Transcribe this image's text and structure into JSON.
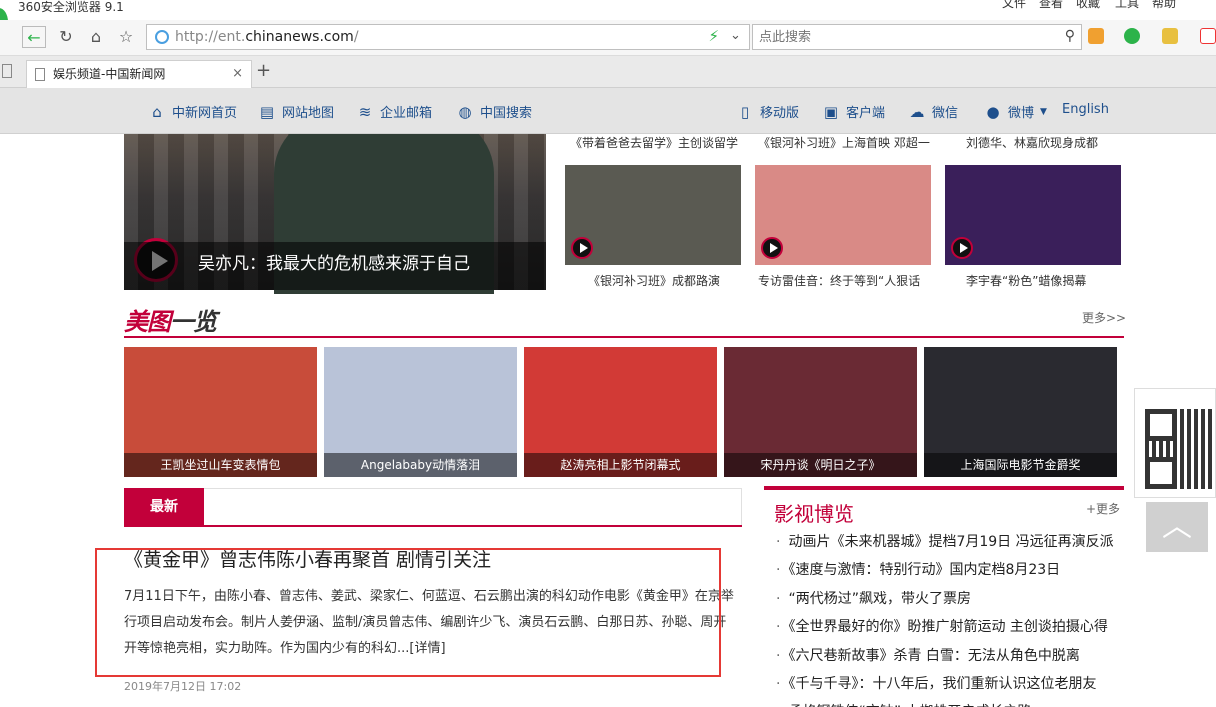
{
  "browser": {
    "title": "360安全浏览器 9.1",
    "menus": [
      "文件",
      "查看",
      "收藏",
      "工具",
      "帮助"
    ],
    "url_prefix": "http://ent.",
    "url_domain": "chinanews.com",
    "url_suffix": "/",
    "search_placeholder": "点此搜索",
    "tab_title": "娱乐频道-中国新闻网",
    "tab_close": "×",
    "new_tab": "+"
  },
  "sitenav": {
    "left": [
      {
        "label": "中新网首页",
        "icon": "home-icon"
      },
      {
        "label": "网站地图",
        "icon": "map-icon"
      },
      {
        "label": "企业邮箱",
        "icon": "rss-icon"
      },
      {
        "label": "中国搜索",
        "icon": "globe-icon"
      }
    ],
    "right": [
      {
        "label": "移动版",
        "icon": "mobile-icon"
      },
      {
        "label": "客户端",
        "icon": "app-icon"
      },
      {
        "label": "微信",
        "icon": "wechat-icon"
      },
      {
        "label": "微博",
        "icon": "weibo-icon"
      },
      {
        "label": "English",
        "icon": ""
      }
    ]
  },
  "hero": {
    "caption": "吴亦凡：我最大的危机感来源于自己"
  },
  "top_row": [
    "《带着爸爸去留学》主创谈留学",
    "《银河补习班》上海首映 邓超一",
    "刘德华、林嘉欣现身成都"
  ],
  "videos": [
    {
      "caption": "《银河补习班》成都路演",
      "color": "#5a5a52"
    },
    {
      "caption": "专访雷佳音：终于等到“人狠话",
      "color": "#d98a86"
    },
    {
      "caption": "李宇春“粉色”蜡像揭幕",
      "color": "#3a1f5a"
    }
  ],
  "meitu": {
    "title_red": "美图",
    "title_dark": "一览",
    "more": "更多>>"
  },
  "photos": [
    {
      "caption": "王凯坐过山车变表情包",
      "color": "#c84c3a"
    },
    {
      "caption": "Angelababy动情落泪",
      "color": "#b9c3d8"
    },
    {
      "caption": "赵涛亮相上影节闭幕式",
      "color": "#d23a36"
    },
    {
      "caption": "宋丹丹谈《明日之子》",
      "color": "#6a2a34"
    },
    {
      "caption": "上海国际电影节金爵奖",
      "color": "#2a2a30"
    }
  ],
  "latest": {
    "tab": "最新",
    "headline": "《黄金甲》曾志伟陈小春再聚首 剧情引关注",
    "summary": "7月11日下午，由陈小春、曾志伟、姜武、梁家仁、何蓝逗、石云鹏出演的科幻动作电影《黄金甲》在京举行项目启动发布会。制片人姜伊涵、监制/演员曾志伟、编剧许少飞、演员石云鹏、白那日苏、孙聪、周开开等惊艳亮相，实力助阵。作为国内少有的科幻...",
    "detail": "[详情]",
    "date": "2019年7月12日  17:02"
  },
  "yingshi": {
    "title": "影视博览",
    "more": "+更多",
    "items": [
      "动画片《未来机器城》提档7月19日 冯远征再演反派",
      "《速度与激情：特别行动》国内定档8月23日",
      "“两代杨过”飙戏，带火了票房",
      "《全世界最好的你》盼推广射箭运动 主创谈拍摄心得",
      "《六尺巷新故事》杀青 白雪：无法从角色中脱离",
      "《千与千寻》：十八年后，我们重新认识这位老朋友",
      "孟格钢铁侠“衣钵” 小蜘蛛开启成长之路"
    ]
  },
  "totop": "︿"
}
